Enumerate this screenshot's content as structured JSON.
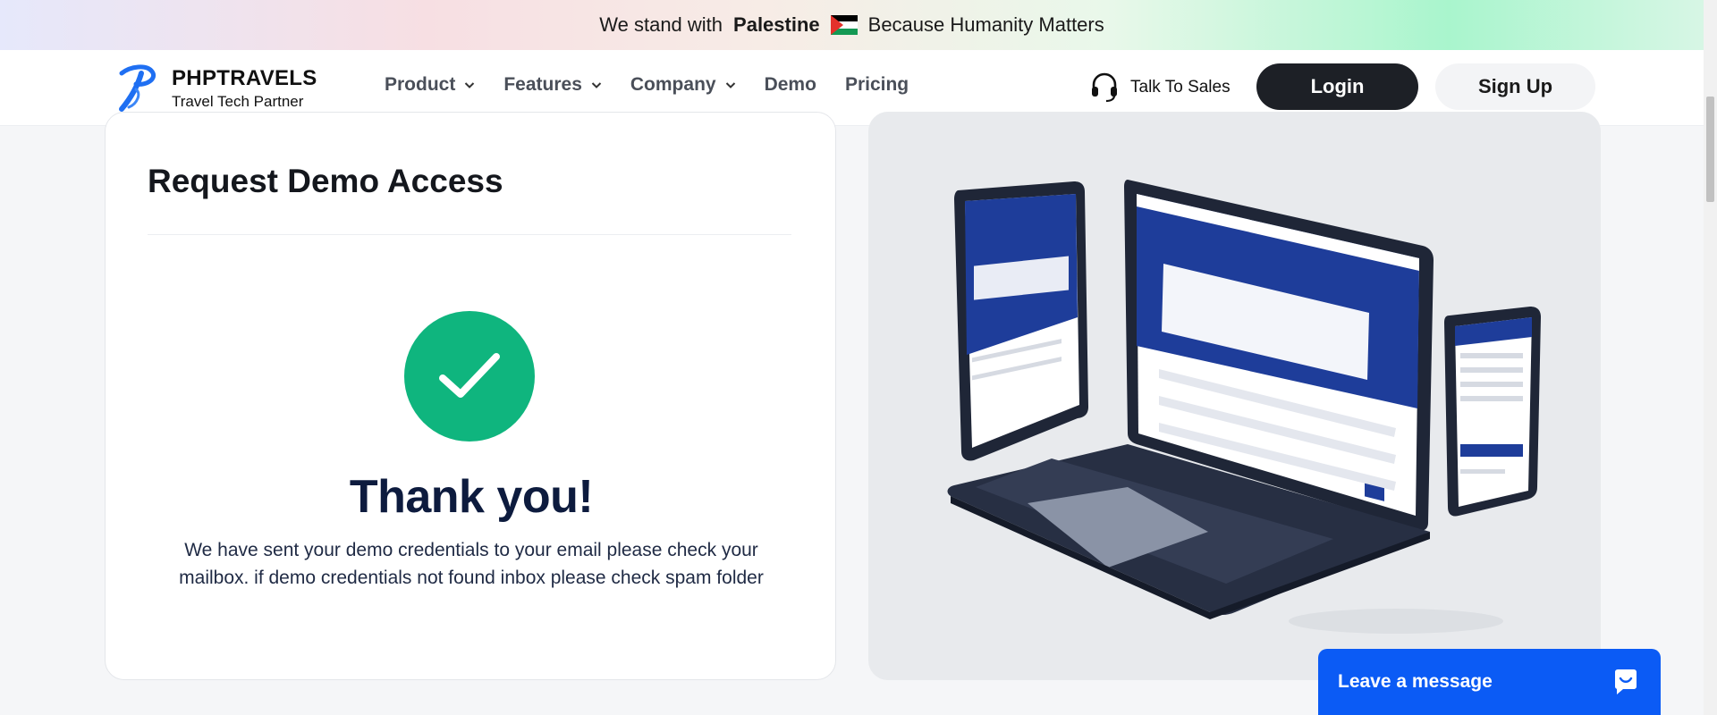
{
  "banner": {
    "prefix": "We stand with",
    "highlight": "Palestine",
    "suffix": "Because Humanity Matters",
    "flag_icon": "palestine-flag-icon"
  },
  "brand": {
    "name": "PHPTRAVELS",
    "tagline": "Travel Tech Partner",
    "logo_color": "#1f6ff2"
  },
  "nav": {
    "items": [
      {
        "label": "Product",
        "has_dropdown": true
      },
      {
        "label": "Features",
        "has_dropdown": true
      },
      {
        "label": "Company",
        "has_dropdown": true
      },
      {
        "label": "Demo",
        "has_dropdown": false
      },
      {
        "label": "Pricing",
        "has_dropdown": false
      }
    ],
    "sales_label": "Talk To Sales",
    "sales_icon": "headset-icon",
    "login_label": "Login",
    "signup_label": "Sign Up"
  },
  "card": {
    "title": "Request Demo Access",
    "success_icon": "checkmark-icon",
    "heading": "Thank you!",
    "message_line1": "We have sent your demo credentials to your email please check your",
    "message_line2": "mailbox. if demo credentials not found inbox please check spam folder"
  },
  "chat": {
    "label": "Leave a message",
    "icon": "chat-bubble-icon"
  },
  "colors": {
    "success": "#0fb57e",
    "login_bg": "#1d2026",
    "chat_bg": "#0b5bf5",
    "heading": "#0d1b3e"
  }
}
